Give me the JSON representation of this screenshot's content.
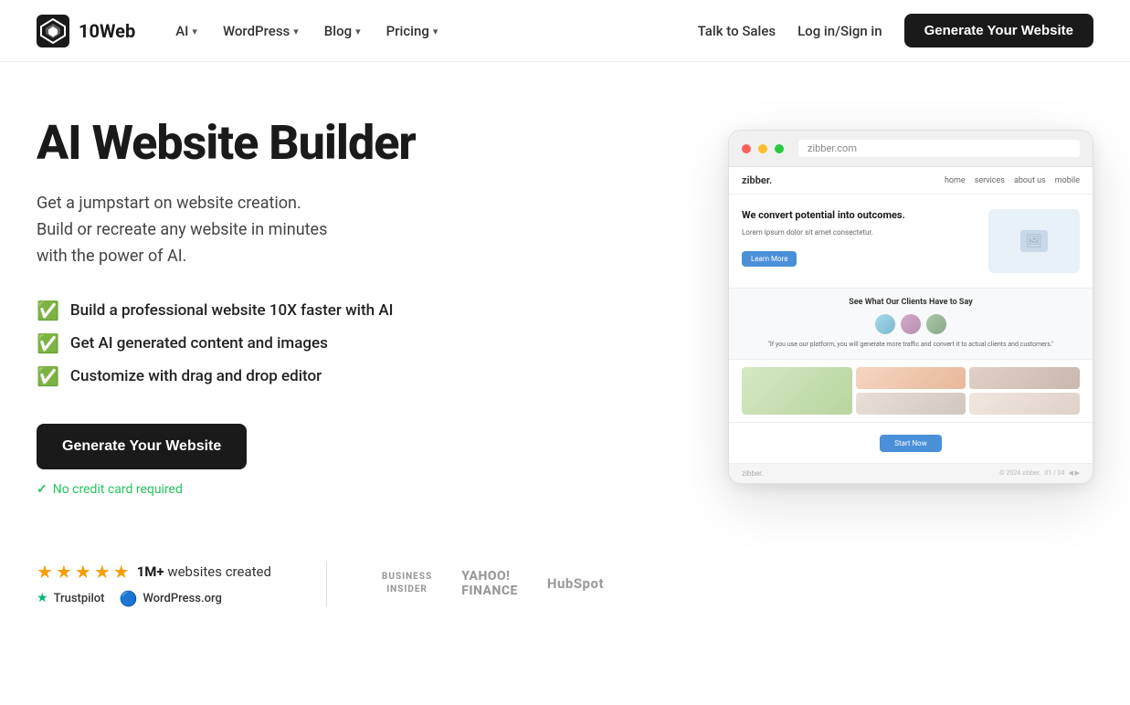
{
  "nav": {
    "logo_text": "10Web",
    "links": [
      {
        "label": "AI",
        "has_dropdown": true
      },
      {
        "label": "WordPress",
        "has_dropdown": true
      },
      {
        "label": "Blog",
        "has_dropdown": true
      },
      {
        "label": "Pricing",
        "has_dropdown": true
      }
    ],
    "right_links": [
      {
        "label": "Talk to Sales"
      },
      {
        "label": "Log in/Sign in"
      }
    ],
    "cta_label": "Generate Your Website"
  },
  "hero": {
    "title": "AI Website Builder",
    "subtitle_line1": "Get a jumpstart on website creation.",
    "subtitle_line2": "Build or recreate any website in minutes",
    "subtitle_line3": "with the power of AI.",
    "features": [
      "Build a professional website 10X faster with AI",
      "Get AI generated content and images",
      "Customize with drag and drop editor"
    ],
    "cta_label": "Generate Your Website",
    "no_card_text": "No credit card required"
  },
  "mockup": {
    "url": "zibber.com",
    "nav_logo": "zibber.",
    "nav_links": [
      "home",
      "services",
      "about us",
      "mobile"
    ],
    "hero_title": "We convert potential into outcomes.",
    "hero_subtitle": "Lorem ipsum dolor sit amet consectetur.",
    "cta_label": "Learn More",
    "testimonials_title": "See What Our Clients Have to Say",
    "testimonial_text": "\"If you use our platform, you will generate more traffic and convert it to actual clients and customers.\"",
    "bottom_cta": "Start Now"
  },
  "bottom": {
    "stars_count": "4.5",
    "websites_prefix": "",
    "websites_count": "1M+",
    "websites_suffix": " websites created",
    "trustpilot_label": "Trustpilot",
    "wordpress_label": "WordPress.org",
    "brands": [
      {
        "label": "BUSINESS\nINSIDER",
        "class": "business-insider"
      },
      {
        "label": "YAHOO!\nFINANCE",
        "class": "yahoo"
      },
      {
        "label": "HubSpot",
        "class": "hubspot"
      }
    ]
  }
}
